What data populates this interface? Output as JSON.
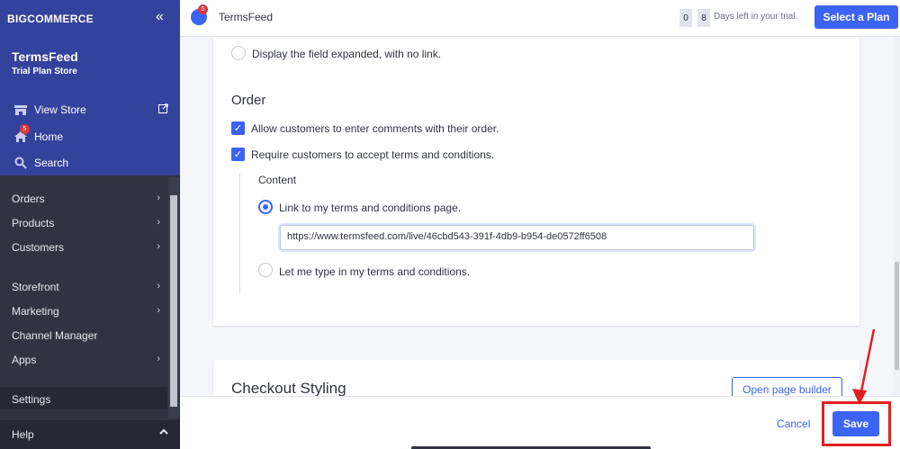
{
  "sidebar": {
    "brand": "BIGCOMMERCE",
    "store_name": "TermsFeed",
    "store_plan": "Trial Plan Store",
    "view_store": "View Store",
    "home": "Home",
    "home_badge": "5",
    "search": "Search",
    "menu": [
      {
        "label": "Orders"
      },
      {
        "label": "Products"
      },
      {
        "label": "Customers"
      },
      {
        "label": "Storefront"
      },
      {
        "label": "Marketing"
      },
      {
        "label": "Channel Manager"
      },
      {
        "label": "Apps"
      },
      {
        "label": "Settings"
      }
    ],
    "help": "Help"
  },
  "topbar": {
    "notif_badge": "5",
    "store_title": "TermsFeed",
    "trial_digit_1": "0",
    "trial_digit_2": "8",
    "trial_text": "Days left in your trial.",
    "select_plan": "Select a Plan"
  },
  "form": {
    "display_expanded": "Display the field expanded, with no link.",
    "order_heading": "Order",
    "allow_comments": "Allow customers to enter comments with their order.",
    "require_terms": "Require customers to accept terms and conditions.",
    "content_heading": "Content",
    "link_option": "Link to my terms and conditions page.",
    "terms_url": "https://www.termsfeed.com/live/46cbd543-391f-4db9-b954-de0572ff6508",
    "type_option": "Let me type in my terms and conditions.",
    "checkout_styling": "Checkout Styling",
    "open_page_builder": "Open page builder"
  },
  "footer": {
    "cancel": "Cancel",
    "save": "Save"
  },
  "colors": {
    "accent": "#3c64f4",
    "sidebar_top": "#34429c",
    "sidebar": "#313440",
    "highlight": "#e02020"
  }
}
